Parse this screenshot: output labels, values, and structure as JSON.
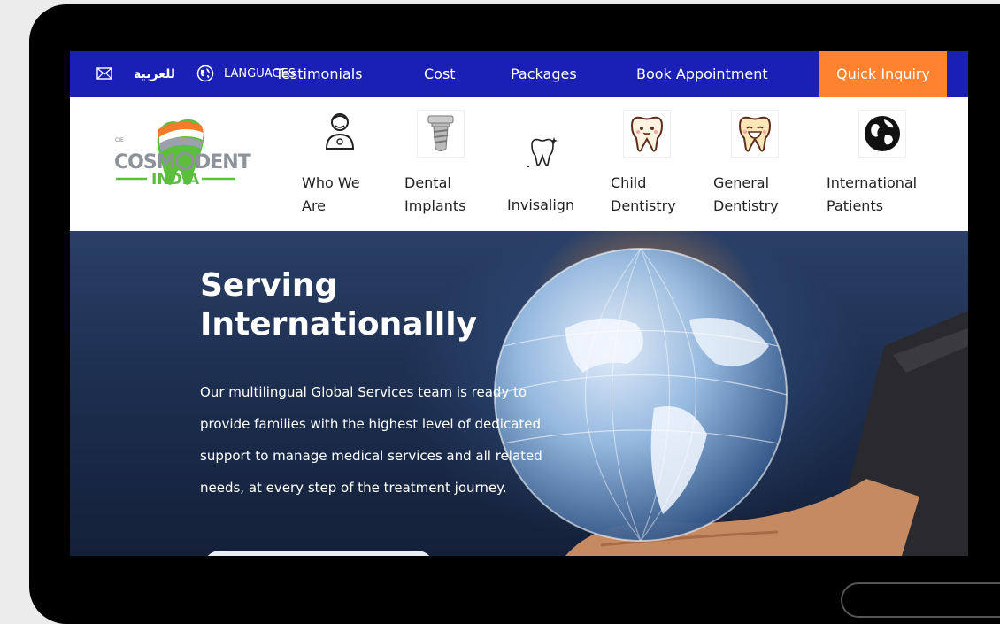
{
  "topbar": {
    "arabic_label": "للعربية",
    "language_label": "LANGUAGES",
    "nav": [
      "Testimonials",
      "Cost",
      "Packages",
      "Book Appointment"
    ],
    "quick_inquiry": "Quick Inquiry",
    "bar_color": "#1a1fb6",
    "accent_color": "#ff8230"
  },
  "logo": {
    "text_top": "COSMODENT",
    "text_bottom": "INDIA",
    "small": "CIE"
  },
  "menu": [
    {
      "label": "Who We Are",
      "icon": "dentist-person-icon"
    },
    {
      "label": "Dental Implants",
      "icon": "dental-implant-icon"
    },
    {
      "label": "Invisalign",
      "icon": "sparkling-tooth-icon"
    },
    {
      "label": "Child Dentistry",
      "icon": "child-tooth-icon"
    },
    {
      "label": "General Dentistry",
      "icon": "smiling-tooth-icon"
    },
    {
      "label": "International Patients",
      "icon": "globe-icon"
    }
  ],
  "hero": {
    "title": "Serving Internationallly",
    "text": "Our multilingual Global Services team is ready to provide families with the highest level of dedicated support to manage medical services and all related needs, at every step of the treatment journey."
  }
}
